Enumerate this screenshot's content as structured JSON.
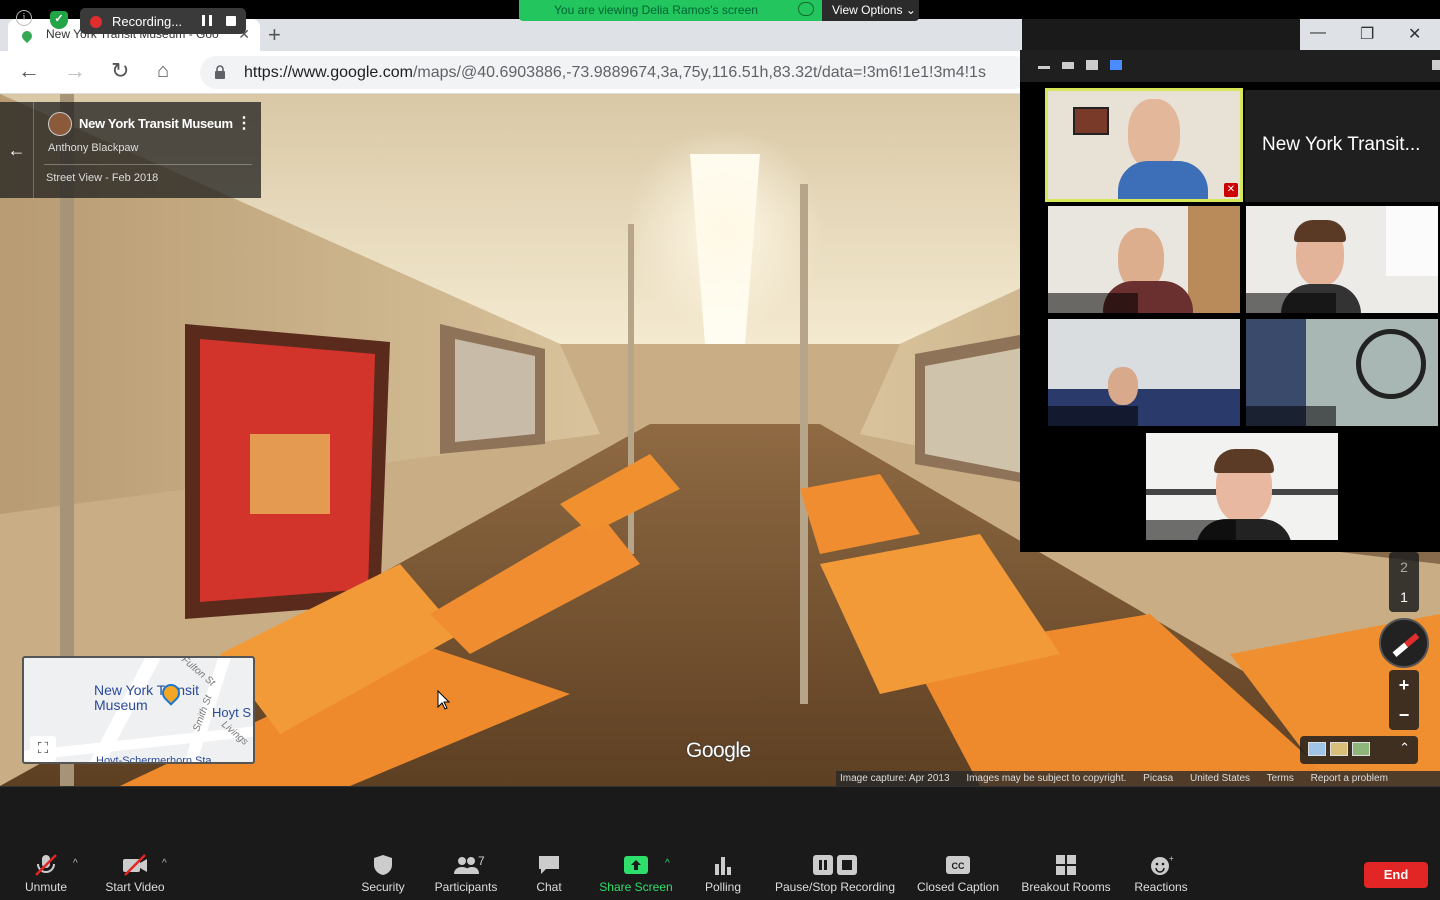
{
  "zoom_top": {
    "recording_label": "Recording...",
    "viewing_text": "You are viewing Delia Ramos's screen",
    "view_options": "View Options"
  },
  "browser": {
    "tab_title": "New York Transit Museum - Goo",
    "url_host": "https://www.google.com",
    "url_path": "/maps/@40.6903886,-73.9889674,3a,75y,116.51h,83.32t/data=!3m6!1e1!3m4!1s"
  },
  "street_view": {
    "place_name": "New York Transit Museum",
    "author": "Anthony Blackpaw",
    "date": "Street View - Feb 2018",
    "map_label": "New York Transit Museum",
    "map_streets": [
      "Fulton St",
      "Smith St",
      "Hoyt S",
      "Livings",
      "Hoyt-Schermerhorn Sta"
    ],
    "logo": "Google",
    "attribution": [
      "Image capture: Apr 2013",
      "Images may be subject to copyright.",
      "Picasa",
      "United States",
      "Terms",
      "Report a problem"
    ],
    "floors": [
      "2",
      "1"
    ],
    "zoom": [
      "+",
      "−"
    ]
  },
  "gallery": {
    "participant_name": "New York Transit..."
  },
  "toolbar": {
    "unmute": "Unmute",
    "start_video": "Start Video",
    "security": "Security",
    "participants": "Participants",
    "participants_count": "7",
    "chat": "Chat",
    "share_screen": "Share Screen",
    "polling": "Polling",
    "pause_stop_recording": "Pause/Stop Recording",
    "closed_caption": "Closed Caption",
    "breakout_rooms": "Breakout Rooms",
    "reactions": "Reactions",
    "end": "End"
  },
  "colors": {
    "share_green": "#2fdf6c",
    "end_red": "#e22525",
    "active_speaker": "#d6e85a"
  }
}
